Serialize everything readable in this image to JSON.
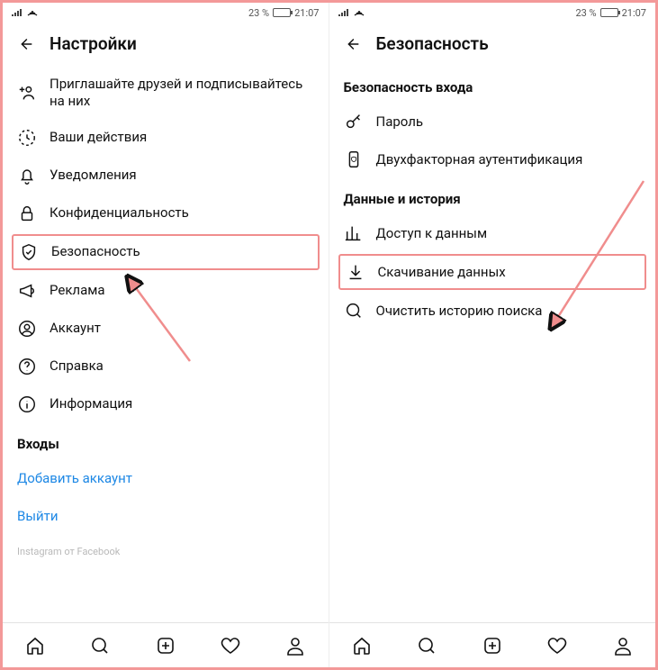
{
  "status": {
    "battery_pct": "23 %",
    "time": "21:07"
  },
  "left": {
    "title": "Настройки",
    "items": [
      {
        "label": "Приглашайте друзей и подписывайтесь на них"
      },
      {
        "label": "Ваши действия"
      },
      {
        "label": "Уведомления"
      },
      {
        "label": "Конфиденциальность"
      },
      {
        "label": "Безопасность"
      },
      {
        "label": "Реклама"
      },
      {
        "label": "Аккаунт"
      },
      {
        "label": "Справка"
      },
      {
        "label": "Информация"
      }
    ],
    "logins_title": "Входы",
    "add_account": "Добавить аккаунт",
    "logout": "Выйти",
    "brand": "Instagram от Facebook"
  },
  "right": {
    "title": "Безопасность",
    "section1": "Безопасность входа",
    "items1": [
      {
        "label": "Пароль"
      },
      {
        "label": "Двухфакторная аутентификация"
      }
    ],
    "section2": "Данные и история",
    "items2": [
      {
        "label": "Доступ к данным"
      },
      {
        "label": "Скачивание данных"
      },
      {
        "label": "Очистить историю поиска"
      }
    ]
  }
}
